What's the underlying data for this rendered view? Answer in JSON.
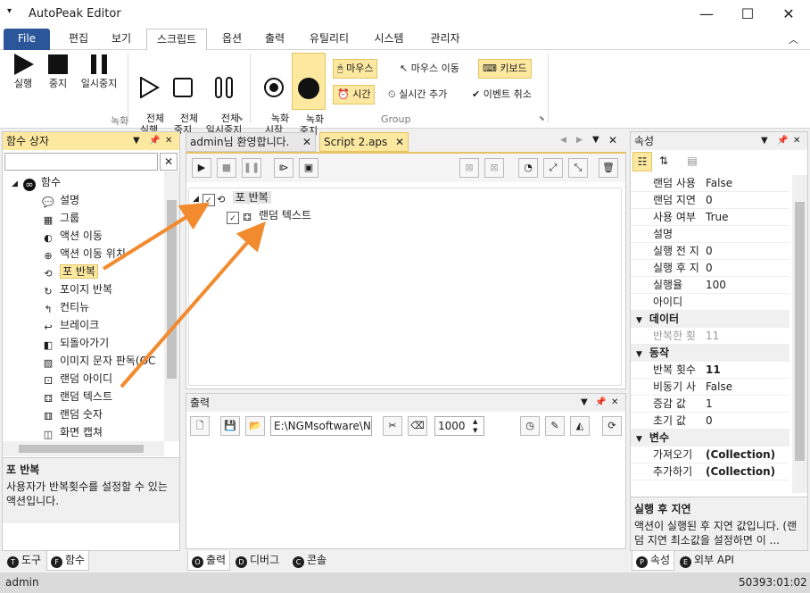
{
  "app": {
    "title": "AutoPeak Editor"
  },
  "menu": {
    "file": "File",
    "tabs": [
      "편집",
      "보기",
      "스크립트",
      "옵션",
      "출력",
      "유틸리티",
      "시스템",
      "관리자"
    ]
  },
  "ribbon": {
    "big": [
      "실행",
      "중지",
      "일시중지",
      "전체\n실행",
      "전체\n중지",
      "전체\n일시중지",
      "녹화\n시작",
      "녹화\n중지"
    ],
    "group_record": "녹화",
    "group_group": "Group",
    "small": {
      "mouse": "마우스",
      "mouse_move": "마우스 이동",
      "keyboard": "키보드",
      "time": "시간",
      "realtime_add": "실시간 추가",
      "event_cancel": "이벤트 취소"
    }
  },
  "left": {
    "title": "함수 상자",
    "root": "함수",
    "items": [
      "설명",
      "그룹",
      "액션 이동",
      "액션 이동 위치",
      "포 반복",
      "포이지 반복",
      "컨티뉴",
      "브레이크",
      "되돌아가기",
      "이미지 문자 판독(OC",
      "랜덤 아이디",
      "랜덤 텍스트",
      "랜덤 숫자",
      "화면 캡쳐"
    ],
    "desc_title": "포 반복",
    "desc_text": "사용자가 반복횟수를 설정할 수 있는 액션입니다.",
    "tabs": [
      {
        "key": "T",
        "label": "도구"
      },
      {
        "key": "F",
        "label": "함수"
      }
    ]
  },
  "doc": {
    "tabs": [
      "admin님 환영합니다.",
      "Script 2.aps"
    ],
    "tree": [
      {
        "label": "포 반복"
      },
      {
        "label": "랜덤 텍스트"
      }
    ]
  },
  "output": {
    "title": "출력",
    "path": "E:\\NGMsoftware\\NG",
    "number": "1000",
    "tabs": [
      {
        "key": "O",
        "label": "출력"
      },
      {
        "key": "D",
        "label": "디버그"
      },
      {
        "key": "C",
        "label": "콘솔"
      }
    ]
  },
  "props": {
    "title": "속성",
    "rows1": [
      {
        "k": "랜덤 사용",
        "v": "False"
      },
      {
        "k": "랜덤 지연",
        "v": "0"
      },
      {
        "k": "사용 여부",
        "v": "True"
      },
      {
        "k": "설명",
        "v": ""
      },
      {
        "k": "실행 전 지",
        "v": "0"
      },
      {
        "k": "실행 후 지",
        "v": "0"
      },
      {
        "k": "실행율",
        "v": "100"
      },
      {
        "k": "아이디",
        "v": ""
      }
    ],
    "cat_data": "데이터",
    "rows2": [
      {
        "k": "반복한 횟",
        "v": "11"
      }
    ],
    "cat_action": "동작",
    "rows3": [
      {
        "k": "반복 횟수",
        "v": "11"
      },
      {
        "k": "비동기 사",
        "v": "False"
      },
      {
        "k": "증감 값",
        "v": "1"
      },
      {
        "k": "초기 값",
        "v": "0"
      }
    ],
    "cat_var": "변수",
    "rows4": [
      {
        "k": "가져오기",
        "v": "(Collection)"
      },
      {
        "k": "추가하기",
        "v": "(Collection)"
      }
    ],
    "desc_title": "실행 후 지연",
    "desc_text": "액션이 실행된 후 지연 값입니다. (랜덤 지연 최소값을 설정하면 이 ...",
    "tabs": [
      {
        "key": "P",
        "label": "속성"
      },
      {
        "key": "E",
        "label": "외부 API"
      }
    ]
  },
  "status": {
    "left": "admin",
    "right": "50393:01:02"
  },
  "colors": {
    "file_tab": "#2b579a",
    "highlight": "#fde8a0",
    "arrow": "#f28a2e"
  }
}
